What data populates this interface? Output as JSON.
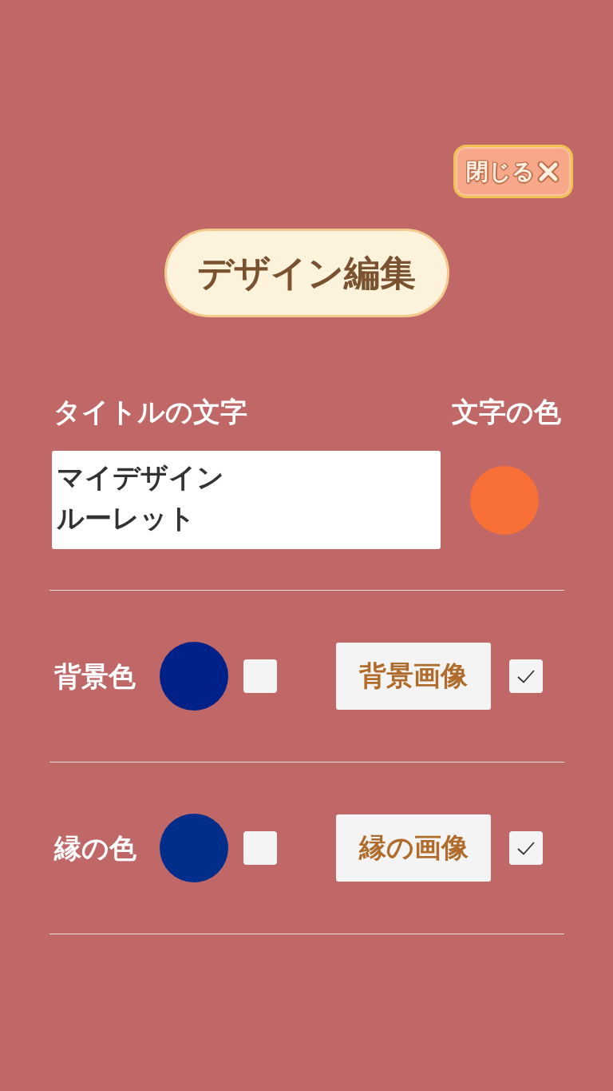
{
  "close_button": {
    "label": "閉じる"
  },
  "title": "デザイン編集",
  "title_text": {
    "label": "タイトルの文字",
    "value": "マイデザインルーレット"
  },
  "text_color": {
    "label": "文字の色",
    "color": "#f87038"
  },
  "rows": [
    {
      "label": "背景色",
      "color": "#002288",
      "color_checked": false,
      "image_button": "背景画像",
      "image_checked": true
    },
    {
      "label": "縁の色",
      "color": "#002e8a",
      "color_checked": false,
      "image_button": "縁の画像",
      "image_checked": true
    }
  ]
}
